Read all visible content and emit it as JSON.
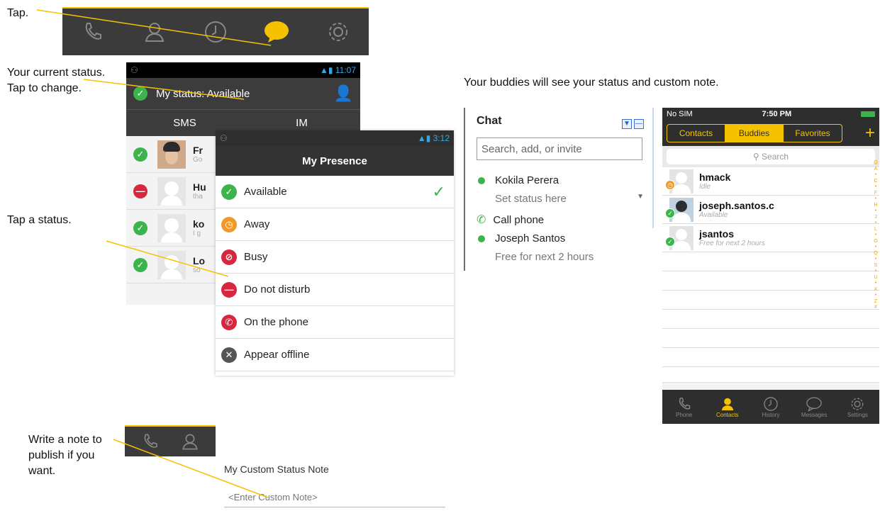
{
  "callouts": {
    "tap": "Tap.",
    "current_status": "Your current status. Tap to change.",
    "tap_status": "Tap a status.",
    "write_note": "Write a note to publish if you want.",
    "buddies_see": "Your buddies will see your status and custom note."
  },
  "android_main": {
    "status_bar_time": "11:07",
    "header_status": "My status: Available",
    "tabs": [
      "SMS",
      "IM"
    ],
    "contacts": [
      {
        "name_fragment": "Fr",
        "sub_fragment": "Go",
        "status": "available"
      },
      {
        "name_fragment": "Hu",
        "sub_fragment": "tha",
        "status": "do-not-disturb"
      },
      {
        "name_fragment": "ko",
        "sub_fragment": "I g",
        "status": "available"
      },
      {
        "name_fragment": "Lo",
        "sub_fragment": "so",
        "status": "available"
      }
    ]
  },
  "presence_popup": {
    "status_bar_time": "3:12",
    "title": "My Presence",
    "items": [
      {
        "label": "Available",
        "icon": "available-icon",
        "selected": true
      },
      {
        "label": "Away",
        "icon": "away-icon",
        "selected": false
      },
      {
        "label": "Busy",
        "icon": "busy-icon",
        "selected": false
      },
      {
        "label": "Do not disturb",
        "icon": "do-not-disturb-icon",
        "selected": false
      },
      {
        "label": "On the phone",
        "icon": "on-the-phone-icon",
        "selected": false
      },
      {
        "label": "Appear offline",
        "icon": "appear-offline-icon",
        "selected": false
      }
    ]
  },
  "custom_note": {
    "title": "My Custom Status Note",
    "placeholder": "<Enter Custom Note>"
  },
  "desktop_chat": {
    "title": "Chat",
    "search_placeholder": "Search, add, or invite",
    "self_name": "Kokila Perera",
    "self_status_prompt": "Set status here",
    "call_phone": "Call phone",
    "buddy_name": "Joseph Santos",
    "buddy_note": "Free for next 2 hours"
  },
  "ios_app": {
    "carrier": "No SIM",
    "time": "7:50 PM",
    "segments": [
      "Contacts",
      "Buddies",
      "Favorites"
    ],
    "active_segment": "Buddies",
    "search_placeholder": "Search",
    "buddies": [
      {
        "name": "hmack",
        "note": "Idle",
        "status": "away"
      },
      {
        "name": "joseph.santos.c",
        "note": "Available",
        "status": "available"
      },
      {
        "name": "jsantos",
        "note": "Free for next 2 hours",
        "status": "available"
      }
    ],
    "index_letters": [
      "Q",
      "A",
      "•",
      "C",
      "•",
      "F",
      "•",
      "H",
      "•",
      "J",
      "•",
      "L",
      "•",
      "O",
      "•",
      "Q",
      "•",
      "S",
      "•",
      "U",
      "•",
      "X",
      "•",
      "Z",
      "#"
    ],
    "tabs": [
      "Phone",
      "Contacts",
      "History",
      "Messages",
      "Settings"
    ],
    "active_tab": "Contacts"
  },
  "colors": {
    "accent_yellow": "#f5c200",
    "available_green": "#3cb44b",
    "dnd_red": "#d7263d",
    "away_orange": "#f0982a",
    "dark_bar": "#3b3b3b"
  }
}
